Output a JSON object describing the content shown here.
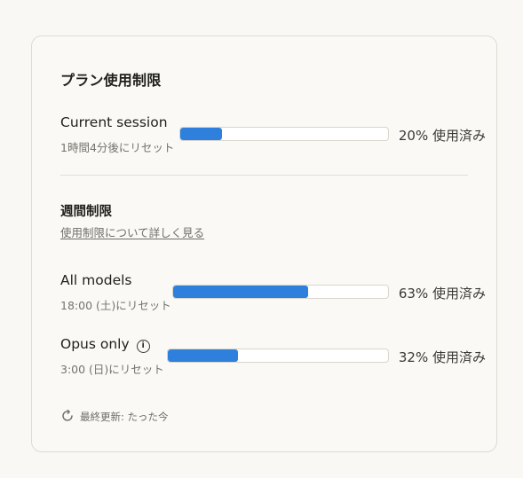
{
  "title": "プラン使用制限",
  "current_session": {
    "label": "Current session",
    "reset": "1時間4分後にリセット",
    "percent": 20,
    "percent_label": "20% 使用済み"
  },
  "weekly": {
    "title": "週間制限",
    "link": "使用制限について詳しく見る",
    "all_models": {
      "label": "All models",
      "reset": "18:00 (土)にリセット",
      "percent": 63,
      "percent_label": "63% 使用済み"
    },
    "opus_only": {
      "label": "Opus only",
      "reset": "3:00 (日)にリセット",
      "percent": 32,
      "percent_label": "32% 使用済み"
    }
  },
  "footer": {
    "label": "最終更新: たった今"
  },
  "icons": {
    "info": "info-icon",
    "refresh": "refresh-icon"
  },
  "colors": {
    "bar_fill": "#2f80dc",
    "background": "#f9f8f4"
  }
}
